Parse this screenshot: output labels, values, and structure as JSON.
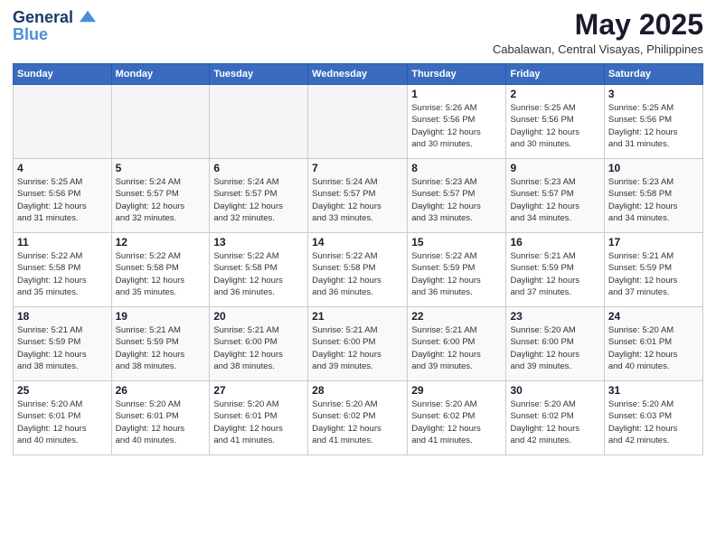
{
  "logo": {
    "line1": "General",
    "line2": "Blue"
  },
  "title": "May 2025",
  "subtitle": "Cabalawan, Central Visayas, Philippines",
  "weekdays": [
    "Sunday",
    "Monday",
    "Tuesday",
    "Wednesday",
    "Thursday",
    "Friday",
    "Saturday"
  ],
  "weeks": [
    [
      {
        "day": "",
        "info": ""
      },
      {
        "day": "",
        "info": ""
      },
      {
        "day": "",
        "info": ""
      },
      {
        "day": "",
        "info": ""
      },
      {
        "day": "1",
        "info": "Sunrise: 5:26 AM\nSunset: 5:56 PM\nDaylight: 12 hours\nand 30 minutes."
      },
      {
        "day": "2",
        "info": "Sunrise: 5:25 AM\nSunset: 5:56 PM\nDaylight: 12 hours\nand 30 minutes."
      },
      {
        "day": "3",
        "info": "Sunrise: 5:25 AM\nSunset: 5:56 PM\nDaylight: 12 hours\nand 31 minutes."
      }
    ],
    [
      {
        "day": "4",
        "info": "Sunrise: 5:25 AM\nSunset: 5:56 PM\nDaylight: 12 hours\nand 31 minutes."
      },
      {
        "day": "5",
        "info": "Sunrise: 5:24 AM\nSunset: 5:57 PM\nDaylight: 12 hours\nand 32 minutes."
      },
      {
        "day": "6",
        "info": "Sunrise: 5:24 AM\nSunset: 5:57 PM\nDaylight: 12 hours\nand 32 minutes."
      },
      {
        "day": "7",
        "info": "Sunrise: 5:24 AM\nSunset: 5:57 PM\nDaylight: 12 hours\nand 33 minutes."
      },
      {
        "day": "8",
        "info": "Sunrise: 5:23 AM\nSunset: 5:57 PM\nDaylight: 12 hours\nand 33 minutes."
      },
      {
        "day": "9",
        "info": "Sunrise: 5:23 AM\nSunset: 5:57 PM\nDaylight: 12 hours\nand 34 minutes."
      },
      {
        "day": "10",
        "info": "Sunrise: 5:23 AM\nSunset: 5:58 PM\nDaylight: 12 hours\nand 34 minutes."
      }
    ],
    [
      {
        "day": "11",
        "info": "Sunrise: 5:22 AM\nSunset: 5:58 PM\nDaylight: 12 hours\nand 35 minutes."
      },
      {
        "day": "12",
        "info": "Sunrise: 5:22 AM\nSunset: 5:58 PM\nDaylight: 12 hours\nand 35 minutes."
      },
      {
        "day": "13",
        "info": "Sunrise: 5:22 AM\nSunset: 5:58 PM\nDaylight: 12 hours\nand 36 minutes."
      },
      {
        "day": "14",
        "info": "Sunrise: 5:22 AM\nSunset: 5:58 PM\nDaylight: 12 hours\nand 36 minutes."
      },
      {
        "day": "15",
        "info": "Sunrise: 5:22 AM\nSunset: 5:59 PM\nDaylight: 12 hours\nand 36 minutes."
      },
      {
        "day": "16",
        "info": "Sunrise: 5:21 AM\nSunset: 5:59 PM\nDaylight: 12 hours\nand 37 minutes."
      },
      {
        "day": "17",
        "info": "Sunrise: 5:21 AM\nSunset: 5:59 PM\nDaylight: 12 hours\nand 37 minutes."
      }
    ],
    [
      {
        "day": "18",
        "info": "Sunrise: 5:21 AM\nSunset: 5:59 PM\nDaylight: 12 hours\nand 38 minutes."
      },
      {
        "day": "19",
        "info": "Sunrise: 5:21 AM\nSunset: 5:59 PM\nDaylight: 12 hours\nand 38 minutes."
      },
      {
        "day": "20",
        "info": "Sunrise: 5:21 AM\nSunset: 6:00 PM\nDaylight: 12 hours\nand 38 minutes."
      },
      {
        "day": "21",
        "info": "Sunrise: 5:21 AM\nSunset: 6:00 PM\nDaylight: 12 hours\nand 39 minutes."
      },
      {
        "day": "22",
        "info": "Sunrise: 5:21 AM\nSunset: 6:00 PM\nDaylight: 12 hours\nand 39 minutes."
      },
      {
        "day": "23",
        "info": "Sunrise: 5:20 AM\nSunset: 6:00 PM\nDaylight: 12 hours\nand 39 minutes."
      },
      {
        "day": "24",
        "info": "Sunrise: 5:20 AM\nSunset: 6:01 PM\nDaylight: 12 hours\nand 40 minutes."
      }
    ],
    [
      {
        "day": "25",
        "info": "Sunrise: 5:20 AM\nSunset: 6:01 PM\nDaylight: 12 hours\nand 40 minutes."
      },
      {
        "day": "26",
        "info": "Sunrise: 5:20 AM\nSunset: 6:01 PM\nDaylight: 12 hours\nand 40 minutes."
      },
      {
        "day": "27",
        "info": "Sunrise: 5:20 AM\nSunset: 6:01 PM\nDaylight: 12 hours\nand 41 minutes."
      },
      {
        "day": "28",
        "info": "Sunrise: 5:20 AM\nSunset: 6:02 PM\nDaylight: 12 hours\nand 41 minutes."
      },
      {
        "day": "29",
        "info": "Sunrise: 5:20 AM\nSunset: 6:02 PM\nDaylight: 12 hours\nand 41 minutes."
      },
      {
        "day": "30",
        "info": "Sunrise: 5:20 AM\nSunset: 6:02 PM\nDaylight: 12 hours\nand 42 minutes."
      },
      {
        "day": "31",
        "info": "Sunrise: 5:20 AM\nSunset: 6:03 PM\nDaylight: 12 hours\nand 42 minutes."
      }
    ]
  ]
}
